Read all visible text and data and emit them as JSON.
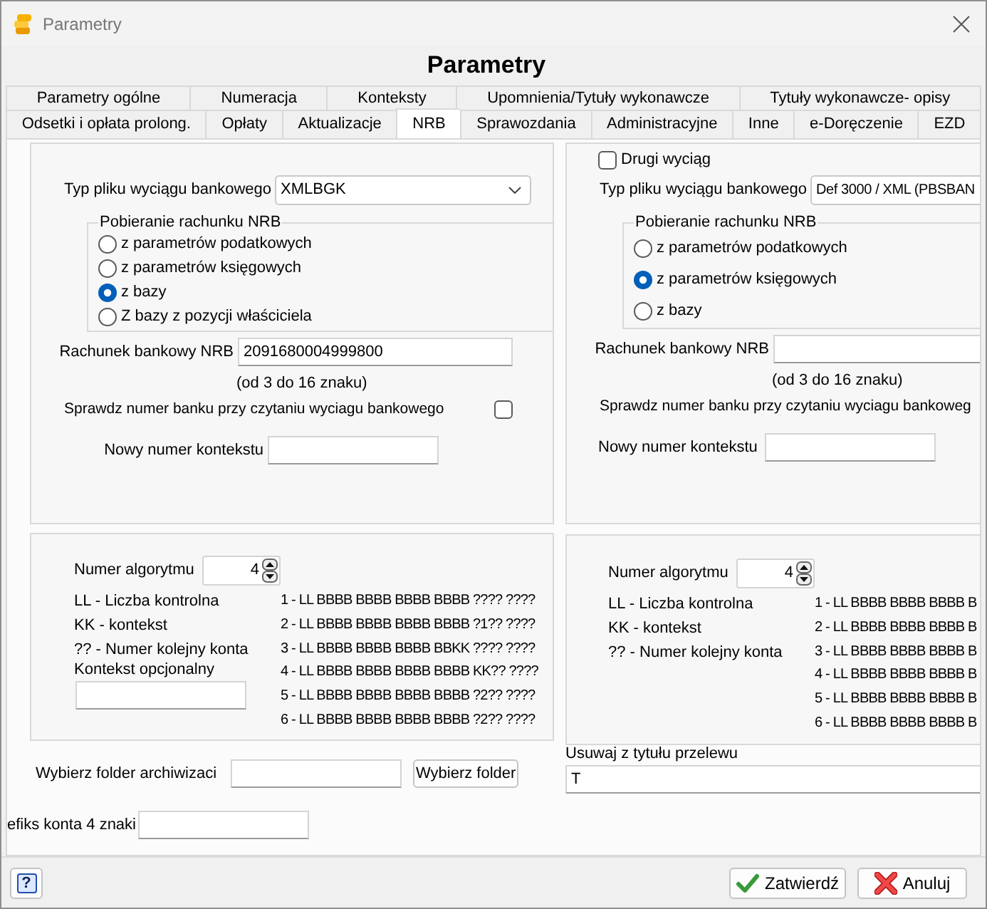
{
  "window": {
    "title": "Parametry"
  },
  "header": {
    "title": "Parametry"
  },
  "tab_rows": [
    {
      "tabs": [
        {
          "label": "Parametry ogólne",
          "selected": false
        },
        {
          "label": "Numeracja",
          "selected": false
        },
        {
          "label": "Konteksty",
          "selected": false
        },
        {
          "label": "Upomnienia/Tytuły wykonawcze",
          "selected": false
        },
        {
          "label": "Tytuły wykonawcze- opisy",
          "selected": false
        }
      ]
    },
    {
      "tabs": [
        {
          "label": "Odsetki i opłata prolong.",
          "selected": false
        },
        {
          "label": "Opłaty",
          "selected": false
        },
        {
          "label": "Aktualizacje",
          "selected": false
        },
        {
          "label": "NRB",
          "selected": true
        },
        {
          "label": "Sprawozdania",
          "selected": false
        },
        {
          "label": "Administracyjne",
          "selected": false
        },
        {
          "label": "Inne",
          "selected": false
        },
        {
          "label": "e-Doręczenie",
          "selected": false
        },
        {
          "label": "EZD",
          "selected": false
        }
      ]
    }
  ],
  "columns": [
    {
      "statement_panel": {
        "file_type": {
          "label": "Typ pliku wyciągu bankowego",
          "value": "XMLBGK"
        },
        "nrb_source": {
          "title": "Pobieranie rachunku NRB",
          "options": [
            {
              "label": "z parametrów podatkowych",
              "selected": false
            },
            {
              "label": "z parametrów księgowych",
              "selected": false
            },
            {
              "label": "z bazy",
              "selected": true
            },
            {
              "label": "Z bazy z pozycji właściciela",
              "selected": false
            }
          ]
        },
        "account": {
          "label": "Rachunek bankowy NRB",
          "value": "2091680004999800",
          "hint": "(od 3 do 16 znaku)"
        },
        "verify_bank": {
          "label": "Sprawdz numer banku przy czytaniu wyciagu bankowego",
          "checked": false
        },
        "new_context": {
          "label": "Nowy numer kontekstu"
        }
      },
      "algorithm_panel": {
        "label": "Numer algorytmu",
        "value": "4",
        "legend": [
          "LL - Liczba kontrolna",
          "KK - kontekst",
          "?? - Numer kolejny konta"
        ],
        "optional_context": {
          "label": "Kontekst opcjonalny"
        },
        "formats": [
          "1 - LL BBBB BBBB BBBB BBBB ???? ????",
          "2 - LL BBBB BBBB BBBB BBBB ?1?? ????",
          "3 - LL BBBB BBBB BBBB BBKK ???? ????",
          "4 - LL BBBB BBBB BBBB BBBB KK?? ????",
          "5 - LL BBBB BBBB BBBB BBBB ?2?? ????",
          "6 - LL BBBB BBBB BBBB BBBB ?2?? ????"
        ]
      },
      "archive_folder": {
        "label": "Wybierz folder archiwizaci",
        "button": "Wybierz folder"
      }
    },
    {
      "statement_panel": {
        "second_statement": {
          "label": "Drugi wyciąg",
          "checked": false
        },
        "file_type": {
          "label": "Typ pliku wyciągu bankowego",
          "value": "Def 3000 / XML (PBSBAN"
        },
        "nrb_source": {
          "title": "Pobieranie rachunku NRB",
          "options": [
            {
              "label": "z parametrów podatkowych",
              "selected": false
            },
            {
              "label": "z parametrów księgowych",
              "selected": true
            },
            {
              "label": "z bazy",
              "selected": false
            }
          ]
        },
        "account": {
          "label": "Rachunek bankowy NRB",
          "hint": "(od 3 do 16 znaku)"
        },
        "verify_bank": {
          "label": "Sprawdz numer banku przy czytaniu wyciagu bankoweg"
        },
        "new_context": {
          "label": "Nowy numer kontekstu"
        }
      },
      "algorithm_panel": {
        "label": "Numer algorytmu",
        "value": "4",
        "legend": [
          "LL - Liczba kontrolna",
          "KK - kontekst",
          "?? - Numer kolejny konta"
        ],
        "formats": [
          "1 - LL BBBB BBBB BBBB B",
          "2 - LL BBBB BBBB BBBB B",
          "3 - LL BBBB BBBB BBBB B",
          "4 - LL BBBB BBBB BBBB B",
          "5 - LL BBBB BBBB BBBB B",
          "6 - LL BBBB BBBB BBBB B"
        ]
      },
      "remove_from_title": {
        "label": "Usuwaj z tytułu przelewu",
        "value": "T"
      }
    }
  ],
  "prefix": {
    "label": "efiks konta 4 znaki"
  },
  "footer": {
    "help": "?",
    "buttons": [
      {
        "label": "Zatwierdź",
        "kind": "confirm"
      },
      {
        "label": "Anuluj",
        "kind": "cancel"
      }
    ]
  }
}
